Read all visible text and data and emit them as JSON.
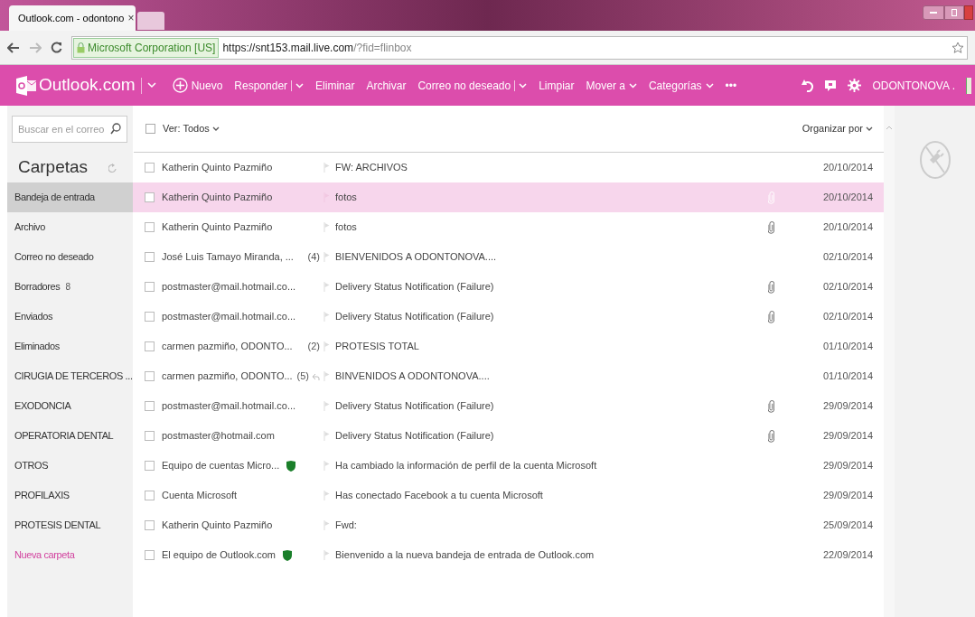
{
  "browser": {
    "tab": {
      "title": "Outlook.com - odontono",
      "close": "×"
    },
    "address": {
      "identity": "Microsoft Corporation [US]",
      "url_host": "https://snt153.mail.live.com",
      "url_rest": "/?fid=flinbox"
    }
  },
  "toolbar": {
    "brand": "Outlook.com",
    "actions": [
      {
        "label": "Nuevo",
        "kind": "new"
      },
      {
        "label": "Responder",
        "kind": "split"
      },
      {
        "label": "Eliminar",
        "kind": "plain"
      },
      {
        "label": "Archivar",
        "kind": "plain"
      },
      {
        "label": "Correo no deseado",
        "kind": "split"
      },
      {
        "label": "Limpiar",
        "kind": "plain"
      },
      {
        "label": "Mover a",
        "kind": "menu"
      },
      {
        "label": "Categorías",
        "kind": "menu"
      },
      {
        "label": "•••",
        "kind": "plain"
      }
    ],
    "account": "ODONTONOVA ."
  },
  "sidebar": {
    "search": {
      "placeholder": "Buscar en el correo"
    },
    "heading": "Carpetas",
    "items": [
      {
        "label": "Bandeja de entrada",
        "selected": true,
        "kind": "folder"
      },
      {
        "label": "Archivo",
        "selected": false,
        "kind": "folder"
      },
      {
        "label": "Correo no deseado",
        "selected": false,
        "kind": "folder"
      },
      {
        "label": "Borradores",
        "count": "8",
        "selected": false,
        "kind": "folder"
      },
      {
        "label": "Enviados",
        "selected": false,
        "kind": "folder"
      },
      {
        "label": "Eliminados",
        "selected": false,
        "kind": "folder"
      },
      {
        "label": "CIRUGIA DE TERCEROS ...",
        "selected": false,
        "kind": "folder"
      },
      {
        "label": "EXODONCIA",
        "selected": false,
        "kind": "folder"
      },
      {
        "label": "OPERATORIA DENTAL",
        "selected": false,
        "kind": "folder"
      },
      {
        "label": "OTROS",
        "selected": false,
        "kind": "folder"
      },
      {
        "label": "PROFILAXIS",
        "selected": false,
        "kind": "folder"
      },
      {
        "label": "PROTESIS DENTAL",
        "selected": false,
        "kind": "folder"
      },
      {
        "label": "Nueva carpeta",
        "selected": false,
        "kind": "action"
      }
    ]
  },
  "list": {
    "select_all_checked": false,
    "filter": "Ver: Todos",
    "sort": "Organizar por",
    "messages": [
      {
        "sender": "Katherin Quinto Pazmiño",
        "subject": "FW: ARCHIVOS",
        "date": "20/10/2014",
        "attachment": false,
        "selected": false
      },
      {
        "sender": "Katherin Quinto Pazmiño",
        "subject": "fotos",
        "date": "20/10/2014",
        "attachment": true,
        "selected": true
      },
      {
        "sender": "Katherin Quinto Pazmiño",
        "subject": "fotos",
        "date": "20/10/2014",
        "attachment": true,
        "selected": false
      },
      {
        "sender": "José Luis Tamayo Miranda, ...",
        "count": "(4)",
        "subject": "BIENVENIDOS A ODONTONOVA....",
        "date": "02/10/2014",
        "attachment": false,
        "selected": false
      },
      {
        "sender": "postmaster@mail.hotmail.co...",
        "subject": "Delivery Status Notification (Failure)",
        "date": "02/10/2014",
        "attachment": true,
        "selected": false
      },
      {
        "sender": "postmaster@mail.hotmail.co...",
        "subject": "Delivery Status Notification (Failure)",
        "date": "02/10/2014",
        "attachment": true,
        "selected": false
      },
      {
        "sender": "carmen pazmiño, ODONTO...",
        "count": "(2)",
        "subject": "PROTESIS TOTAL",
        "date": "01/10/2014",
        "attachment": false,
        "selected": false
      },
      {
        "sender": "carmen pazmiño, ODONTO...",
        "count": "(5)",
        "replied": true,
        "subject": "BINVENIDOS A ODONTONOVA....",
        "date": "01/10/2014",
        "attachment": false,
        "selected": false
      },
      {
        "sender": "postmaster@mail.hotmail.co...",
        "subject": "Delivery Status Notification (Failure)",
        "date": "29/09/2014",
        "attachment": true,
        "selected": false
      },
      {
        "sender": "postmaster@hotmail.com",
        "subject": "Delivery Status Notification (Failure)",
        "date": "29/09/2014",
        "attachment": true,
        "selected": false
      },
      {
        "sender": "Equipo de cuentas Micro...",
        "verified": true,
        "subject": "Ha cambiado la información de perfil de la cuenta Microsoft",
        "date": "29/09/2014",
        "attachment": false,
        "selected": false
      },
      {
        "sender": "Cuenta Microsoft",
        "subject": "Has conectado Facebook a tu cuenta Microsoft",
        "date": "29/09/2014",
        "attachment": false,
        "selected": false
      },
      {
        "sender": "Katherin Quinto Pazmiño",
        "subject": "Fwd:",
        "date": "25/09/2014",
        "attachment": false,
        "selected": false
      },
      {
        "sender": "El equipo de Outlook.com",
        "verified": true,
        "subject": "Bienvenido a la nueva bandeja de entrada de Outlook.com",
        "date": "22/09/2014",
        "attachment": false,
        "selected": false
      }
    ]
  }
}
